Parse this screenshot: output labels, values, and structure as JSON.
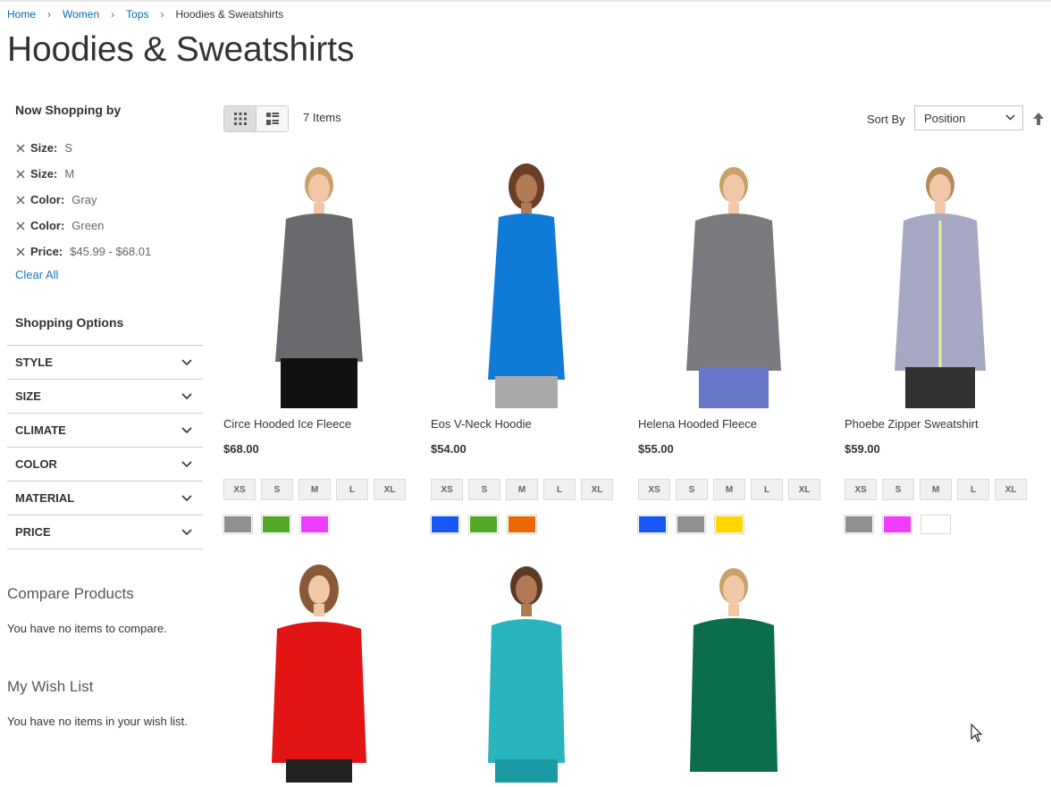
{
  "breadcrumbs": {
    "items": [
      "Home",
      "Women",
      "Tops"
    ],
    "current": "Hoodies & Sweatshirts"
  },
  "page_title": "Hoodies & Sweatshirts",
  "sidebar": {
    "now_shopping_title": "Now Shopping by",
    "active_filters": [
      {
        "label": "Size:",
        "value": "S"
      },
      {
        "label": "Size:",
        "value": "M"
      },
      {
        "label": "Color:",
        "value": "Gray"
      },
      {
        "label": "Color:",
        "value": "Green"
      },
      {
        "label": "Price:",
        "value": "$45.99 - $68.01"
      }
    ],
    "clear_all": "Clear All",
    "shopping_options_title": "Shopping Options",
    "options": [
      "STYLE",
      "SIZE",
      "CLIMATE",
      "COLOR",
      "MATERIAL",
      "PRICE"
    ],
    "compare_title": "Compare Products",
    "compare_text": "You have no items to compare.",
    "wishlist_title": "My Wish List",
    "wishlist_text": "You have no items in your wish list."
  },
  "toolbar": {
    "amount": "7 Items",
    "sort_label": "Sort By",
    "sort_value": "Position",
    "modes": [
      "grid-mode",
      "list-mode"
    ]
  },
  "products": [
    {
      "name": "Circe Hooded Ice Fleece",
      "price": "$68.00",
      "sizes": [
        "XS",
        "S",
        "M",
        "L",
        "XL"
      ],
      "swatches": [
        "#8f8f8f",
        "#53a828",
        "#ef3dff"
      ],
      "garment": "#6a6a6e",
      "hair": "#c9a067"
    },
    {
      "name": "Eos V-Neck Hoodie",
      "price": "$54.00",
      "sizes": [
        "XS",
        "S",
        "M",
        "L",
        "XL"
      ],
      "swatches": [
        "#1857f7",
        "#53a828",
        "#eb6703"
      ],
      "garment": "#0f7bd6",
      "hair": "#6b3f26"
    },
    {
      "name": "Helena Hooded Fleece",
      "price": "$55.00",
      "sizes": [
        "XS",
        "S",
        "M",
        "L",
        "XL"
      ],
      "swatches": [
        "#1857f7",
        "#8f8f8f",
        "#ffd500"
      ],
      "garment": "#7a7b7e",
      "hair": "#c9a067"
    },
    {
      "name": "Phoebe Zipper Sweatshirt",
      "price": "$59.00",
      "sizes": [
        "XS",
        "S",
        "M",
        "L",
        "XL"
      ],
      "swatches": [
        "#8f8f8f",
        "#ef3dff",
        "#ffffff"
      ],
      "garment": "#a6a8c4",
      "hair": "#b58a55"
    },
    {
      "garment": "#e31414",
      "hair": "#8a5a36"
    },
    {
      "garment": "#2ab4bd",
      "hair": "#5c3a24"
    },
    {
      "garment": "#0c6d4c",
      "hair": "#c9a067"
    }
  ]
}
